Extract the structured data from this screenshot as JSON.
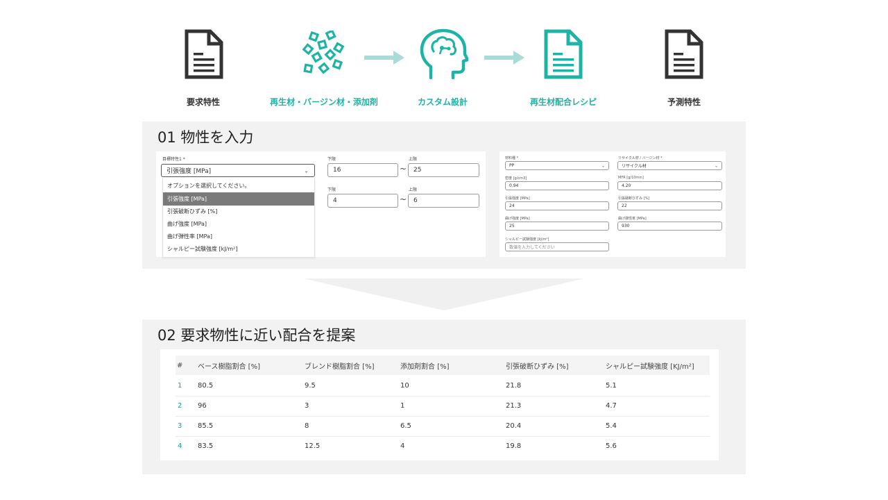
{
  "flow": {
    "steps": [
      {
        "label": "要求特性",
        "icon": "document-icon"
      },
      {
        "label": "再生材・バージン材・添加剤",
        "icon": "materials-icon"
      },
      {
        "label": "カスタム設計",
        "icon": "ai-brain-icon"
      },
      {
        "label": "再生材配合レシピ",
        "icon": "recipe-document-icon"
      },
      {
        "label": "予測特性",
        "icon": "document-icon"
      }
    ],
    "colors": {
      "teal": "#1fb3a6",
      "dark": "#333333",
      "arrow": "#a9dcd6"
    }
  },
  "section1": {
    "title": "01 物性を入力",
    "target": {
      "label": "目標特性1 *",
      "selected": "引張強度 [MPa]",
      "options": [
        "オプションを選択してください。",
        "引張強度 [MPa]",
        "引張破断ひずみ [%]",
        "曲げ強度 [MPa]",
        "曲げ弾性率 [MPa]",
        "シャルピー試験強度 [kJ/m²]"
      ],
      "selected_index": 1
    },
    "ranges": [
      {
        "lower_label": "下限",
        "lower": "16",
        "upper_label": "上限",
        "upper": "25"
      },
      {
        "lower_label": "下限",
        "lower": "4",
        "upper_label": "上限",
        "upper": "6"
      }
    ],
    "tilde": "~",
    "material": {
      "material_type_label": "材料種 *",
      "material_type": "PP",
      "recycle_label": "リサイクル材 / バージン材 *",
      "recycle": "リサイクル材",
      "fields": [
        {
          "label": "密度 [g/cm3]",
          "value": "0.94"
        },
        {
          "label": "MFR [g/10min]",
          "value": "4.20"
        },
        {
          "label": "引張強度 [MPa]",
          "value": "24"
        },
        {
          "label": "引張破断ひずみ [%]",
          "value": "22"
        },
        {
          "label": "曲げ強度 [MPa]",
          "value": "25"
        },
        {
          "label": "曲げ弾性率 [MPa]",
          "value": "930"
        }
      ],
      "charpy_label": "シャルピー試験強度 [kJ/m²]",
      "charpy_placeholder": "数値を入力してください"
    }
  },
  "section2": {
    "title": "02 要求物性に近い配合を提案",
    "columns": [
      "#",
      "ベース樹脂割合 [%]",
      "ブレンド樹脂割合 [%]",
      "添加剤割合 [%]",
      "引張破断ひずみ [%]",
      "シャルピー試験強度 [KJ/m²]"
    ],
    "rows": [
      [
        "1",
        "80.5",
        "9.5",
        "10",
        "21.8",
        "5.1"
      ],
      [
        "2",
        "96",
        "3",
        "1",
        "21.3",
        "4.7"
      ],
      [
        "3",
        "85.5",
        "8",
        "6.5",
        "20.4",
        "5.4"
      ],
      [
        "4",
        "83.5",
        "12.5",
        "4",
        "19.8",
        "5.6"
      ]
    ]
  }
}
